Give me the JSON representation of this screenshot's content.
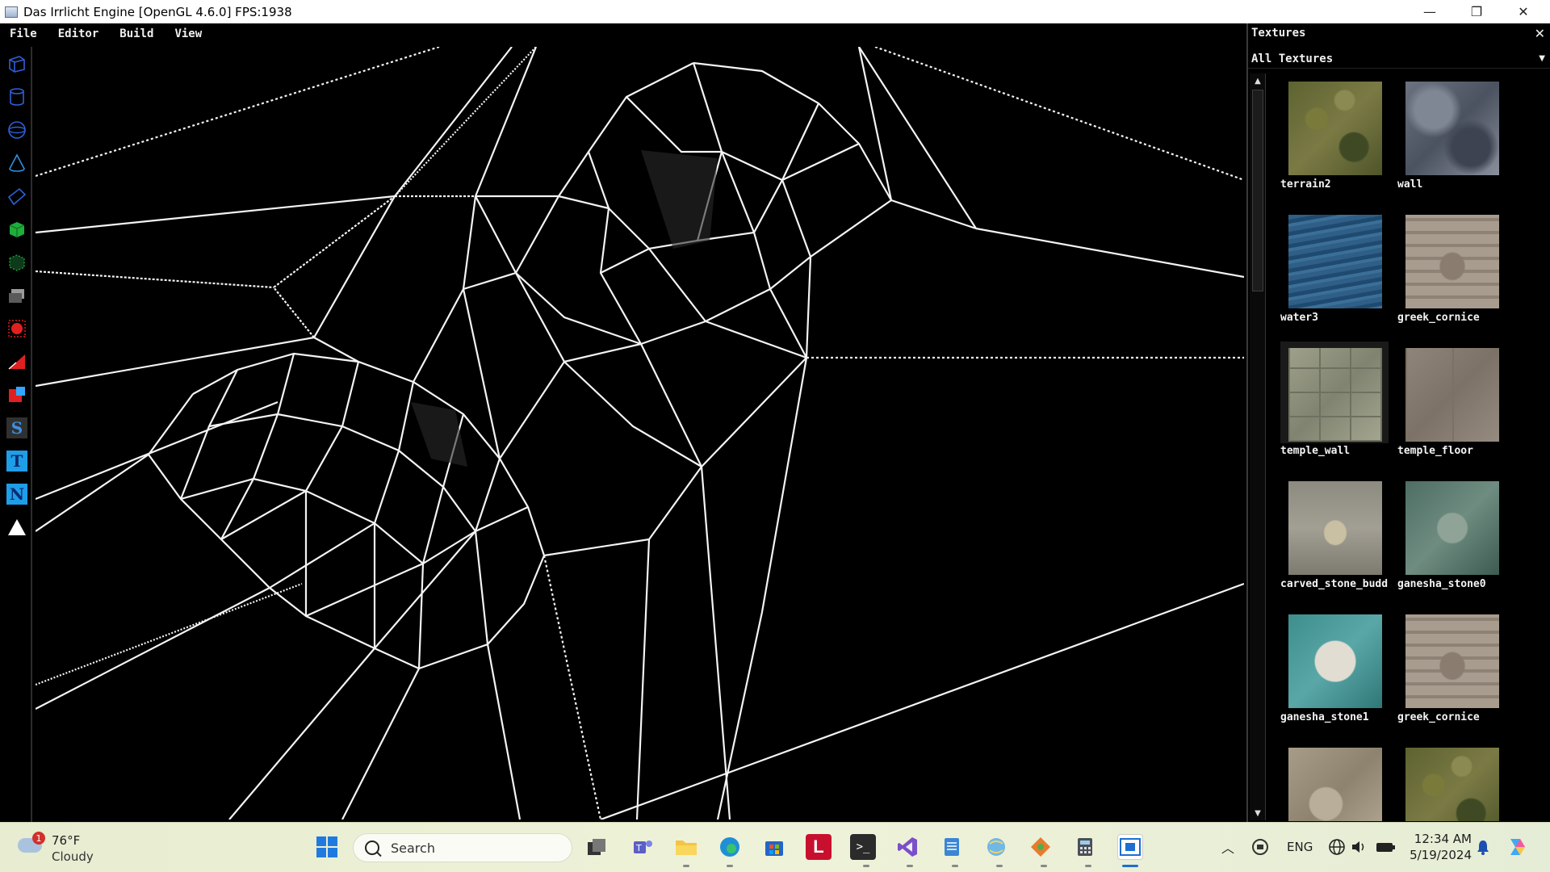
{
  "window": {
    "title": "Das Irrlicht Engine  [OpenGL 4.6.0] FPS:1938",
    "minimize_glyph": "—",
    "restore_glyph": "❐",
    "close_glyph": "✕"
  },
  "menu": {
    "items": [
      {
        "label": "File"
      },
      {
        "label": "Editor"
      },
      {
        "label": "Build"
      },
      {
        "label": "View"
      }
    ]
  },
  "toolbar": {
    "tools": [
      {
        "name": "box-wire-icon"
      },
      {
        "name": "cylinder-icon"
      },
      {
        "name": "sphere-icon"
      },
      {
        "name": "cone-icon"
      },
      {
        "name": "plane-icon"
      },
      {
        "name": "cube-solid-icon"
      },
      {
        "name": "cube-dotted-icon"
      },
      {
        "name": "layers-icon"
      },
      {
        "name": "light-icon"
      },
      {
        "name": "clip-icon"
      },
      {
        "name": "paint-icon"
      },
      {
        "name": "s-tool-icon",
        "letter": "S"
      },
      {
        "name": "t-tool-icon",
        "letter": "T"
      },
      {
        "name": "n-tool-icon",
        "letter": "N"
      },
      {
        "name": "triangle-tool-icon"
      }
    ]
  },
  "panel": {
    "title": "Textures",
    "close_glyph": "✕",
    "filter": "All Textures",
    "textures": [
      {
        "name": "terrain2",
        "tex": "t-terrain"
      },
      {
        "name": "wall",
        "tex": "t-wall"
      },
      {
        "name": "water3",
        "tex": "t-water"
      },
      {
        "name": "greek_cornice",
        "tex": "t-cornice"
      },
      {
        "name": "temple_wall",
        "tex": "t-temple-wall",
        "selected": true
      },
      {
        "name": "temple_floor",
        "tex": "t-temple-floor"
      },
      {
        "name": "carved_stone_budd",
        "tex": "t-buddha"
      },
      {
        "name": "ganesha_stone0",
        "tex": "t-ganesha0"
      },
      {
        "name": "ganesha_stone1",
        "tex": "t-ganesha1"
      },
      {
        "name": "greek_cornice",
        "tex": "t-cornice"
      },
      {
        "name": "",
        "tex": "t-relief"
      },
      {
        "name": "",
        "tex": "t-terrain"
      }
    ]
  },
  "taskbar": {
    "weather_temp": "76°F",
    "weather_cond": "Cloudy",
    "weather_badge": "1",
    "search_text": "Search",
    "language": "ENG",
    "time": "12:34 AM",
    "date": "5/19/2024",
    "colors": {
      "start": "#1f7ae0",
      "edge": "#1f8fd6",
      "store": "#2463c9",
      "lens": "#c8102e",
      "terminal": "#2b2b2b",
      "vs": "#7b4fc9",
      "notepad": "#3a86d4",
      "accent": "#1d6fd1"
    }
  }
}
